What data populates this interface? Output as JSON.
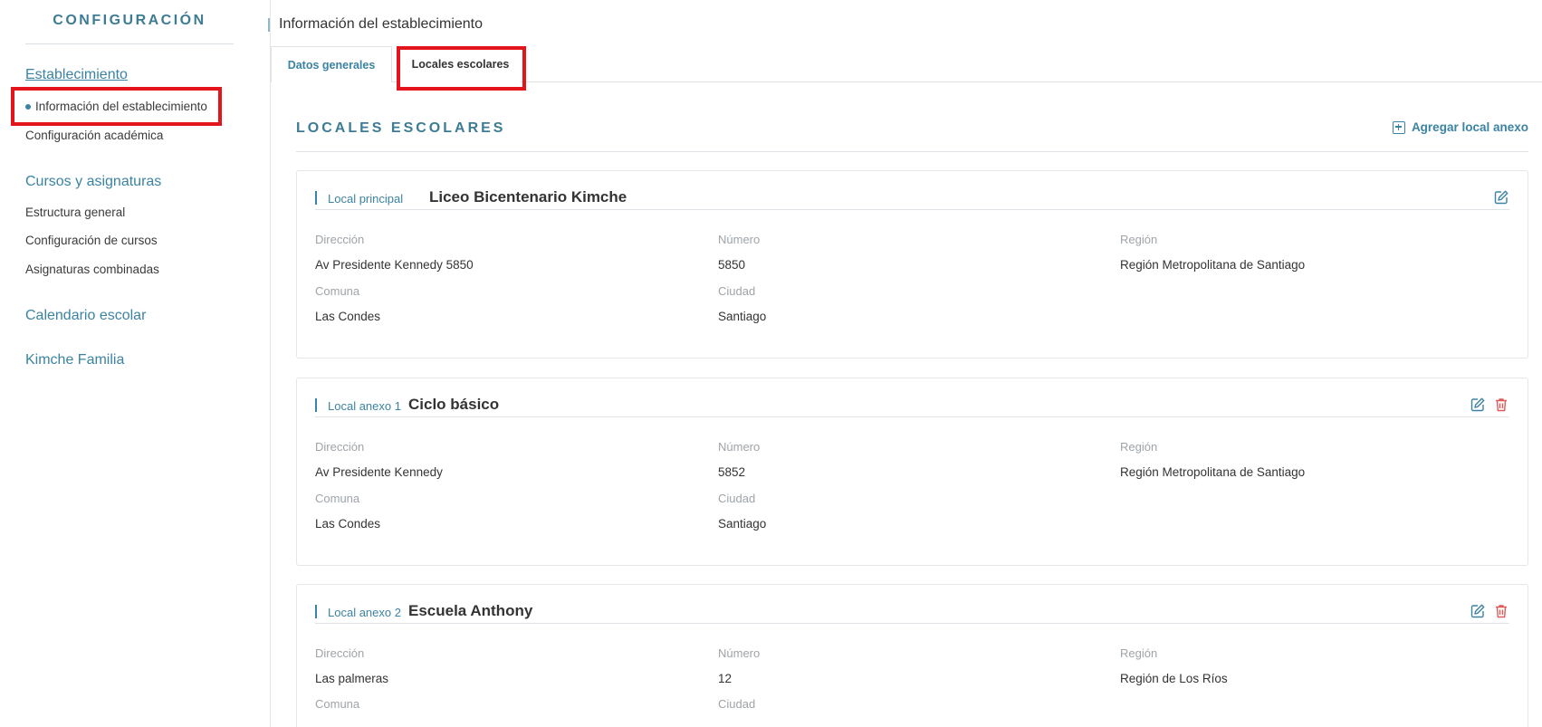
{
  "sidebar": {
    "title": "CONFIGURACIÓN",
    "sections": [
      {
        "label": "Establecimiento",
        "items": [
          "Información del establecimiento",
          "Configuración académica"
        ]
      },
      {
        "label": "Cursos y asignaturas",
        "items": [
          "Estructura general",
          "Configuración de cursos",
          "Asignaturas combinadas"
        ]
      },
      {
        "label": "Calendario escolar",
        "items": []
      },
      {
        "label": "Kimche Familia",
        "items": []
      }
    ]
  },
  "header": {
    "breadcrumb": "Información del establecimiento"
  },
  "tabs": [
    {
      "label": "Datos generales",
      "active": false
    },
    {
      "label": "Locales escolares",
      "active": true
    }
  ],
  "section": {
    "title": "LOCALES ESCOLARES",
    "add_label": "Agregar local anexo"
  },
  "labels": {
    "direccion": "Dirección",
    "numero": "Número",
    "region": "Región",
    "comuna": "Comuna",
    "ciudad": "Ciudad"
  },
  "locales": [
    {
      "type": "Local principal",
      "name": "Liceo Bicentenario Kimche",
      "direccion": "Av Presidente Kennedy 5850",
      "numero": "5850",
      "region": "Región Metropolitana de Santiago",
      "comuna": "Las Condes",
      "ciudad": "Santiago"
    },
    {
      "type": "Local anexo 1",
      "name": "Ciclo básico",
      "direccion": "Av Presidente Kennedy",
      "numero": "5852",
      "region": "Región Metropolitana de Santiago",
      "comuna": "Las Condes",
      "ciudad": "Santiago"
    },
    {
      "type": "Local anexo 2",
      "name": "Escuela Anthony",
      "direccion": "Las palmeras",
      "numero": "12",
      "region": "Región de Los Ríos",
      "comuna": "",
      "ciudad": ""
    }
  ],
  "colors": {
    "accent": "#3b83a3",
    "highlight": "#e3141b",
    "delete": "#e05a5a"
  },
  "icons": {
    "add": "plus-square-icon",
    "edit": "edit-icon",
    "delete": "trash-icon"
  }
}
